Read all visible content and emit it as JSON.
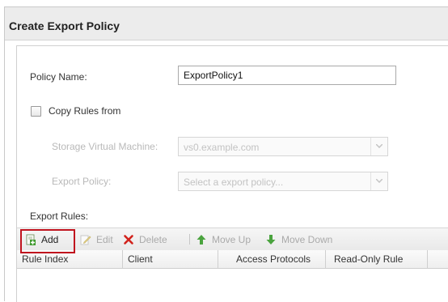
{
  "dialog": {
    "title": "Create Export Policy"
  },
  "form": {
    "policy_name_label": "Policy Name:",
    "policy_name_value": "ExportPolicy1",
    "copy_rules_label": "Copy Rules from",
    "copy_rules_checked": false,
    "svm_label": "Storage Virtual Machine:",
    "svm_value": "vs0.example.com",
    "export_policy_label": "Export Policy:",
    "export_policy_placeholder": "Select a export policy..."
  },
  "rules": {
    "section_label": "Export Rules:",
    "toolbar": {
      "add": "Add",
      "edit": "Edit",
      "delete": "Delete",
      "move_up": "Move Up",
      "move_down": "Move Down"
    },
    "columns": [
      "Rule Index",
      "Client",
      "Access Protocols",
      "Read-Only Rule"
    ]
  },
  "colors": {
    "highlight": "#c0141e",
    "delete_icon": "#d2221c",
    "move_icon": "#4aa33e",
    "add_icon": "#3f9a2e"
  },
  "icons": {
    "add": "add-document-icon",
    "edit": "edit-pencil-icon",
    "delete": "delete-x-icon",
    "move_up": "arrow-up-icon",
    "move_down": "arrow-down-icon",
    "dropdown": "chevron-down-icon"
  }
}
